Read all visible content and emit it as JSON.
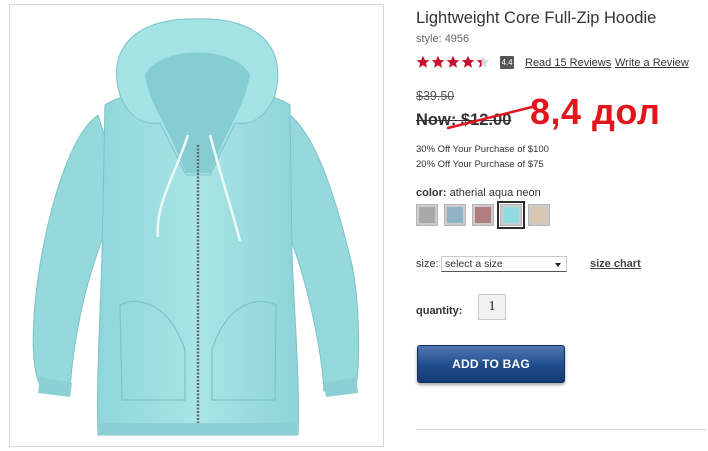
{
  "product": {
    "title": "Lightweight Core Full-Zip Hoodie",
    "style_label": "style:",
    "style_number": "4956",
    "rating": 4.4,
    "rating_badge": "4.4",
    "stars_out_of": 5,
    "read_reviews": "Read 15 Reviews",
    "write_review": "Write a Review"
  },
  "price": {
    "original": "$39.50",
    "now": "Now: $12.00",
    "annotation": "8,4 дол",
    "annotation_color": "#e2151b"
  },
  "promos": [
    "30% Off Your Purchase of $100",
    "20% Off Your Purchase of $75"
  ],
  "color": {
    "label": "color:",
    "selected_name": "atherial aqua neon",
    "swatches": [
      {
        "name": "heather gray",
        "color": "#a9a9a9",
        "selected": false
      },
      {
        "name": "heather blue",
        "color": "#8fb2c4",
        "selected": false
      },
      {
        "name": "heather red",
        "color": "#b27d80",
        "selected": false
      },
      {
        "name": "atherial aqua neon",
        "color": "#8edbe3",
        "selected": true
      },
      {
        "name": "heather oatmeal",
        "color": "#d8c8b2",
        "selected": false
      }
    ]
  },
  "size": {
    "label": "size:",
    "placeholder": "select a size",
    "chart_link": "size chart"
  },
  "quantity": {
    "label": "quantity:",
    "value": "1"
  },
  "cart": {
    "add_label": "ADD TO BAG",
    "button_color": "#1f4b8c"
  },
  "image": {
    "garment_color": "#9ee0e3"
  }
}
